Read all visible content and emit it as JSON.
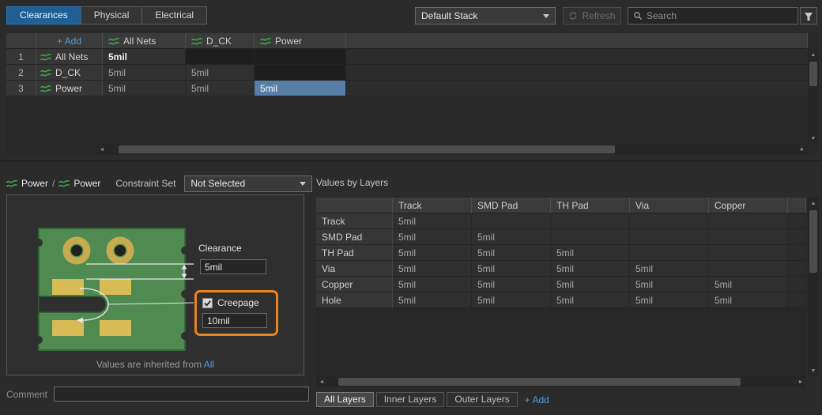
{
  "colors": {
    "accent_blue": "#4f9ee0",
    "selection_blue": "#567ea6",
    "highlight_orange": "#ea8220",
    "net_green": "#3fae4a",
    "board_green": "#4f8a50",
    "pad_gold": "#d8bb55",
    "active_tab_blue": "#1f5f93"
  },
  "icons": {
    "net_class": "wave-lines",
    "search": "magnifier",
    "refresh": "circular-arrows",
    "filter": "funnel",
    "dropdown": "caret-down",
    "checkbox_check": "check",
    "scroll_left": "◄",
    "scroll_right": "►",
    "scroll_up": "▲",
    "scroll_down": "▼"
  },
  "tabs": [
    {
      "label": "Clearances",
      "active": true
    },
    {
      "label": "Physical",
      "active": false
    },
    {
      "label": "Electrical",
      "active": false
    }
  ],
  "toolbar": {
    "stack_dropdown_value": "Default Stack",
    "refresh_label": "Refresh",
    "search_placeholder": "Search"
  },
  "net_matrix": {
    "add_label": "+ Add",
    "columns": [
      "All Nets",
      "D_CK",
      "Power"
    ],
    "rows": [
      {
        "num": "1",
        "name": "All Nets",
        "emphasis": true,
        "values": [
          "5mil",
          null,
          null
        ]
      },
      {
        "num": "2",
        "name": "D_CK",
        "emphasis": false,
        "values": [
          "5mil",
          "5mil",
          null
        ]
      },
      {
        "num": "3",
        "name": "Power",
        "emphasis": false,
        "values": [
          "5mil",
          "5mil",
          "5mil"
        ]
      }
    ],
    "selected": {
      "row": 2,
      "col": 2
    }
  },
  "detail": {
    "pair_left": "Power",
    "pair_separator": "/",
    "pair_right": "Power",
    "constraint_set_label": "Constraint Set",
    "constraint_set_value": "Not Selected",
    "clearance_label": "Clearance",
    "clearance_value": "5mil",
    "creepage_label": "Creepage",
    "creepage_checked": true,
    "creepage_value": "10mil",
    "inherited_text": "Values are inherited from",
    "inherited_link": "All",
    "comment_label": "Comment",
    "comment_value": ""
  },
  "layers_panel": {
    "title": "Values by Layers",
    "columns": [
      "Track",
      "SMD Pad",
      "TH Pad",
      "Via",
      "Copper"
    ],
    "rows": [
      {
        "name": "Track",
        "values": [
          "5mil",
          null,
          null,
          null,
          null
        ]
      },
      {
        "name": "SMD Pad",
        "values": [
          "5mil",
          "5mil",
          null,
          null,
          null
        ]
      },
      {
        "name": "TH Pad",
        "values": [
          "5mil",
          "5mil",
          "5mil",
          null,
          null
        ]
      },
      {
        "name": "Via",
        "values": [
          "5mil",
          "5mil",
          "5mil",
          "5mil",
          null
        ]
      },
      {
        "name": "Copper",
        "values": [
          "5mil",
          "5mil",
          "5mil",
          "5mil",
          "5mil"
        ]
      },
      {
        "name": "Hole",
        "values": [
          "5mil",
          "5mil",
          "5mil",
          "5mil",
          "5mil"
        ]
      }
    ],
    "layer_tabs": [
      {
        "label": "All Layers",
        "active": true
      },
      {
        "label": "Inner Layers",
        "active": false
      },
      {
        "label": "Outer Layers",
        "active": false
      }
    ],
    "add_label": "+ Add"
  }
}
